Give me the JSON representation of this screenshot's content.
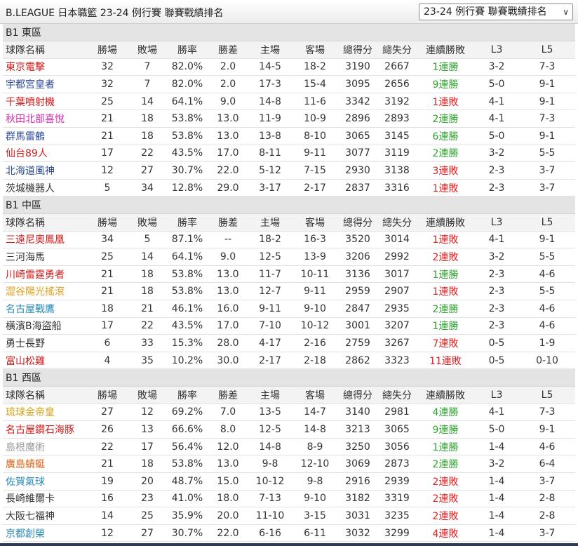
{
  "header": {
    "title": "B.LEAGUE 日本職籃 23-24 例行賽 聯賽戰績排名",
    "season_select": "23-24 例行賽 聯賽戰績排名"
  },
  "colors": {
    "streak_win": "#2ea32e",
    "streak_loss": "#e02020"
  },
  "columns": [
    "球隊名稱",
    "勝場",
    "敗場",
    "勝率",
    "勝差",
    "主場",
    "客場",
    "總得分",
    "總失分",
    "連續勝敗",
    "L3",
    "L5"
  ],
  "divisions": [
    {
      "name": "B1 東區",
      "teams": [
        {
          "team": "東京電擊",
          "color": "#d01a1a",
          "w": "32",
          "l": "7",
          "pct": "82.0%",
          "gb": "2.0",
          "home": "14-5",
          "away": "18-2",
          "pf": "3190",
          "pa": "2667",
          "streak": "1連勝",
          "streak_type": "win",
          "l3": "3-2",
          "l5": "7-3"
        },
        {
          "team": "宇都宮皇者",
          "color": "#2b4a9a",
          "w": "32",
          "l": "7",
          "pct": "82.0%",
          "gb": "2.0",
          "home": "17-3",
          "away": "15-4",
          "pf": "3095",
          "pa": "2656",
          "streak": "9連勝",
          "streak_type": "win",
          "l3": "5-0",
          "l5": "9-1"
        },
        {
          "team": "千葉噴射機",
          "color": "#d01a1a",
          "w": "25",
          "l": "14",
          "pct": "64.1%",
          "gb": "9.0",
          "home": "14-8",
          "away": "11-6",
          "pf": "3342",
          "pa": "3192",
          "streak": "1連敗",
          "streak_type": "loss",
          "l3": "4-1",
          "l5": "9-1"
        },
        {
          "team": "秋田北部喜悅",
          "color": "#d42ab0",
          "w": "21",
          "l": "18",
          "pct": "53.8%",
          "gb": "13.0",
          "home": "11-9",
          "away": "10-9",
          "pf": "2896",
          "pa": "2893",
          "streak": "2連勝",
          "streak_type": "win",
          "l3": "4-1",
          "l5": "7-3"
        },
        {
          "team": "群馬雷鶴",
          "color": "#2b4a9a",
          "w": "21",
          "l": "18",
          "pct": "53.8%",
          "gb": "13.0",
          "home": "13-8",
          "away": "8-10",
          "pf": "3065",
          "pa": "3145",
          "streak": "6連勝",
          "streak_type": "win",
          "l3": "5-0",
          "l5": "9-1"
        },
        {
          "team": "仙台89人",
          "color": "#d01a1a",
          "w": "17",
          "l": "22",
          "pct": "43.5%",
          "gb": "17.0",
          "home": "8-11",
          "away": "9-11",
          "pf": "3077",
          "pa": "3119",
          "streak": "2連勝",
          "streak_type": "win",
          "l3": "3-2",
          "l5": "5-5"
        },
        {
          "team": "北海道風神",
          "color": "#2b4a9a",
          "w": "12",
          "l": "27",
          "pct": "30.7%",
          "gb": "22.0",
          "home": "5-12",
          "away": "7-15",
          "pf": "2930",
          "pa": "3138",
          "streak": "3連敗",
          "streak_type": "loss",
          "l3": "2-3",
          "l5": "3-7"
        },
        {
          "team": "茨城機器人",
          "color": "#333333",
          "w": "5",
          "l": "34",
          "pct": "12.8%",
          "gb": "29.0",
          "home": "3-17",
          "away": "2-17",
          "pf": "2837",
          "pa": "3316",
          "streak": "1連敗",
          "streak_type": "loss",
          "l3": "2-3",
          "l5": "3-7"
        }
      ]
    },
    {
      "name": "B1 中區",
      "teams": [
        {
          "team": "三遠尼奧鳳凰",
          "color": "#d01a1a",
          "w": "34",
          "l": "5",
          "pct": "87.1%",
          "gb": "--",
          "home": "18-2",
          "away": "16-3",
          "pf": "3520",
          "pa": "3014",
          "streak": "1連敗",
          "streak_type": "loss",
          "l3": "4-1",
          "l5": "9-1"
        },
        {
          "team": "三河海馬",
          "color": "#333333",
          "w": "25",
          "l": "14",
          "pct": "64.1%",
          "gb": "9.0",
          "home": "12-5",
          "away": "13-9",
          "pf": "3206",
          "pa": "2992",
          "streak": "2連敗",
          "streak_type": "loss",
          "l3": "3-2",
          "l5": "5-5"
        },
        {
          "team": "川崎雷霆勇者",
          "color": "#d01a1a",
          "w": "21",
          "l": "18",
          "pct": "53.8%",
          "gb": "13.0",
          "home": "11-7",
          "away": "10-11",
          "pf": "3136",
          "pa": "3017",
          "streak": "1連勝",
          "streak_type": "win",
          "l3": "2-3",
          "l5": "4-6"
        },
        {
          "team": "澀谷陽光搖滾",
          "color": "#e0a020",
          "w": "21",
          "l": "18",
          "pct": "53.8%",
          "gb": "13.0",
          "home": "12-7",
          "away": "9-11",
          "pf": "2959",
          "pa": "2907",
          "streak": "1連敗",
          "streak_type": "loss",
          "l3": "2-3",
          "l5": "5-5"
        },
        {
          "team": "名古屋戰鷹",
          "color": "#2a8ab8",
          "w": "18",
          "l": "21",
          "pct": "46.1%",
          "gb": "16.0",
          "home": "9-11",
          "away": "9-10",
          "pf": "2847",
          "pa": "2935",
          "streak": "2連勝",
          "streak_type": "win",
          "l3": "2-3",
          "l5": "4-6"
        },
        {
          "team": "橫濱B海盜船",
          "color": "#333333",
          "w": "17",
          "l": "22",
          "pct": "43.5%",
          "gb": "17.0",
          "home": "7-10",
          "away": "10-12",
          "pf": "3001",
          "pa": "3207",
          "streak": "1連勝",
          "streak_type": "win",
          "l3": "2-3",
          "l5": "4-6"
        },
        {
          "team": "勇士長野",
          "color": "#333333",
          "w": "6",
          "l": "33",
          "pct": "15.3%",
          "gb": "28.0",
          "home": "4-17",
          "away": "2-16",
          "pf": "2759",
          "pa": "3267",
          "streak": "7連敗",
          "streak_type": "loss",
          "l3": "0-5",
          "l5": "1-9"
        },
        {
          "team": "富山松雞",
          "color": "#d01a1a",
          "w": "4",
          "l": "35",
          "pct": "10.2%",
          "gb": "30.0",
          "home": "2-17",
          "away": "2-18",
          "pf": "2862",
          "pa": "3323",
          "streak": "11連敗",
          "streak_type": "loss",
          "l3": "0-5",
          "l5": "0-10"
        }
      ]
    },
    {
      "name": "B1 西區",
      "teams": [
        {
          "team": "琉球金帝皇",
          "color": "#d4a010",
          "w": "27",
          "l": "12",
          "pct": "69.2%",
          "gb": "7.0",
          "home": "13-5",
          "away": "14-7",
          "pf": "3140",
          "pa": "2981",
          "streak": "4連勝",
          "streak_type": "win",
          "l3": "4-1",
          "l5": "7-3"
        },
        {
          "team": "名古屋鑽石海豚",
          "color": "#d01a1a",
          "w": "26",
          "l": "13",
          "pct": "66.6%",
          "gb": "8.0",
          "home": "12-5",
          "away": "14-8",
          "pf": "3213",
          "pa": "3065",
          "streak": "9連勝",
          "streak_type": "win",
          "l3": "5-0",
          "l5": "9-1"
        },
        {
          "team": "島根魔術",
          "color": "#9a9a9a",
          "w": "22",
          "l": "17",
          "pct": "56.4%",
          "gb": "12.0",
          "home": "14-8",
          "away": "8-9",
          "pf": "3250",
          "pa": "3056",
          "streak": "1連勝",
          "streak_type": "win",
          "l3": "1-4",
          "l5": "4-6"
        },
        {
          "team": "廣島蜻蜓",
          "color": "#e06010",
          "w": "21",
          "l": "18",
          "pct": "53.8%",
          "gb": "13.0",
          "home": "9-8",
          "away": "12-10",
          "pf": "3069",
          "pa": "2873",
          "streak": "2連勝",
          "streak_type": "win",
          "l3": "3-2",
          "l5": "6-4"
        },
        {
          "team": "佐賀氣球",
          "color": "#2a8ab8",
          "w": "19",
          "l": "20",
          "pct": "48.7%",
          "gb": "15.0",
          "home": "10-12",
          "away": "9-8",
          "pf": "2916",
          "pa": "2939",
          "streak": "2連敗",
          "streak_type": "loss",
          "l3": "1-4",
          "l5": "3-7"
        },
        {
          "team": "長崎維爾卡",
          "color": "#333333",
          "w": "16",
          "l": "23",
          "pct": "41.0%",
          "gb": "18.0",
          "home": "7-13",
          "away": "9-10",
          "pf": "3182",
          "pa": "3319",
          "streak": "2連敗",
          "streak_type": "loss",
          "l3": "1-4",
          "l5": "2-8"
        },
        {
          "team": "大阪七福神",
          "color": "#333333",
          "w": "14",
          "l": "25",
          "pct": "35.9%",
          "gb": "20.0",
          "home": "11-10",
          "away": "3-15",
          "pf": "3031",
          "pa": "3235",
          "streak": "2連敗",
          "streak_type": "loss",
          "l3": "1-4",
          "l5": "2-8"
        },
        {
          "team": "京都創榮",
          "color": "#2a8ab8",
          "w": "12",
          "l": "27",
          "pct": "30.7%",
          "gb": "22.0",
          "home": "6-16",
          "away": "6-11",
          "pf": "3032",
          "pa": "3299",
          "streak": "4連敗",
          "streak_type": "loss",
          "l3": "1-4",
          "l5": "3-7"
        }
      ]
    }
  ]
}
